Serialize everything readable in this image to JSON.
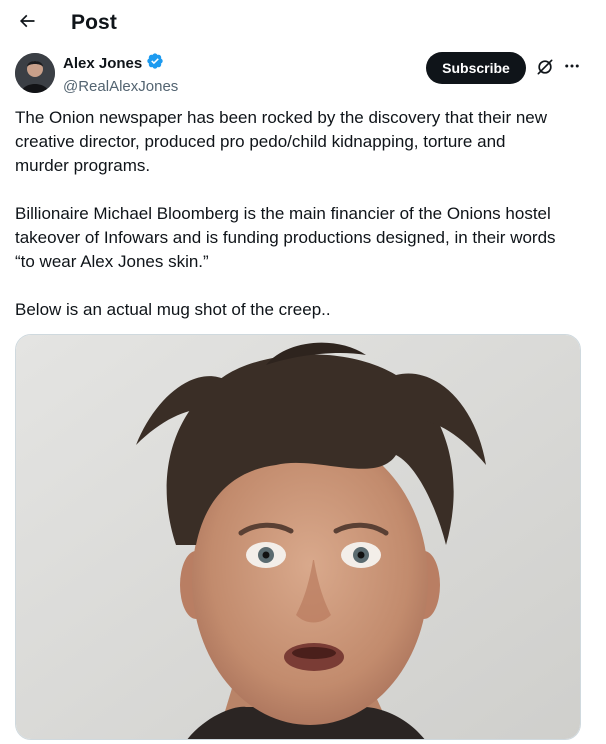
{
  "header": {
    "title": "Post",
    "back_icon": "arrow-left-icon"
  },
  "author": {
    "display_name": "Alex Jones",
    "handle": "@RealAlexJones",
    "verified_icon": "verified-badge-icon",
    "verified_color": "#1d9bf0"
  },
  "actions": {
    "subscribe_label": "Subscribe",
    "grok_icon": "grok-icon",
    "more_icon": "more-dots-icon"
  },
  "tweet": {
    "paragraphs": [
      "The Onion newspaper has been rocked by the discovery that their new\ncreative director, produced pro pedo/child kidnapping, torture and\nmurder programs.",
      "Billionaire Michael Bloomberg is the main financier of the Onions hostel\ntakeover of Infowars and is funding productions designed, in their words\n“to wear Alex Jones skin.”",
      "Below is an actual mug shot of the creep.."
    ]
  },
  "media": {
    "type": "photo",
    "subject": "mugshot-photo"
  },
  "colors": {
    "text_primary": "#0f1419",
    "text_secondary": "#536471",
    "subscribe_bg": "#0f1419",
    "border": "#cfd9de"
  }
}
